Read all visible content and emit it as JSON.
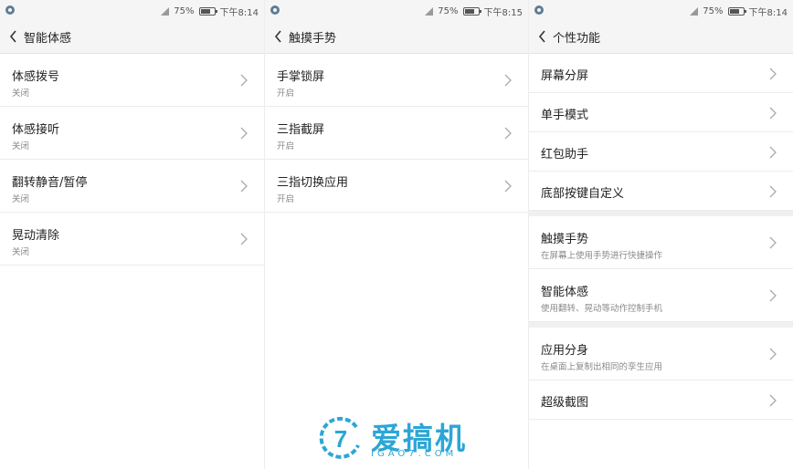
{
  "colors": {
    "accent": "#2ca6d6",
    "title_bar": "#f5f5f5",
    "divider": "#ececec"
  },
  "panels": [
    {
      "status": {
        "battery": "75%",
        "time": "下午8:14"
      },
      "title": "智能体感",
      "items": [
        {
          "label": "体感拨号",
          "sub": "关闭"
        },
        {
          "label": "体感接听",
          "sub": "关闭"
        },
        {
          "label": "翻转静音/暂停",
          "sub": "关闭"
        },
        {
          "label": "晃动清除",
          "sub": "关闭"
        }
      ]
    },
    {
      "status": {
        "battery": "75%",
        "time": "下午8:15"
      },
      "title": "触摸手势",
      "items": [
        {
          "label": "手掌锁屏",
          "sub": "开启"
        },
        {
          "label": "三指截屏",
          "sub": "开启"
        },
        {
          "label": "三指切换应用",
          "sub": "开启"
        }
      ]
    },
    {
      "status": {
        "battery": "75%",
        "time": "下午8:14"
      },
      "title": "个性功能",
      "items": [
        {
          "label": "屏幕分屏"
        },
        {
          "label": "单手模式"
        },
        {
          "label": "红包助手"
        },
        {
          "label": "底部按键自定义"
        },
        {
          "label": "触摸手势",
          "sub": "在屏幕上使用手势进行快捷操作"
        },
        {
          "label": "智能体感",
          "sub": "使用翻转、晃动等动作控制手机"
        },
        {
          "label": "应用分身",
          "sub": "在桌面上复制出相同的孪生应用"
        },
        {
          "label": "超级截图"
        }
      ]
    }
  ],
  "watermark": {
    "brand": "爱搞机",
    "url": "IGAO7.COM"
  }
}
